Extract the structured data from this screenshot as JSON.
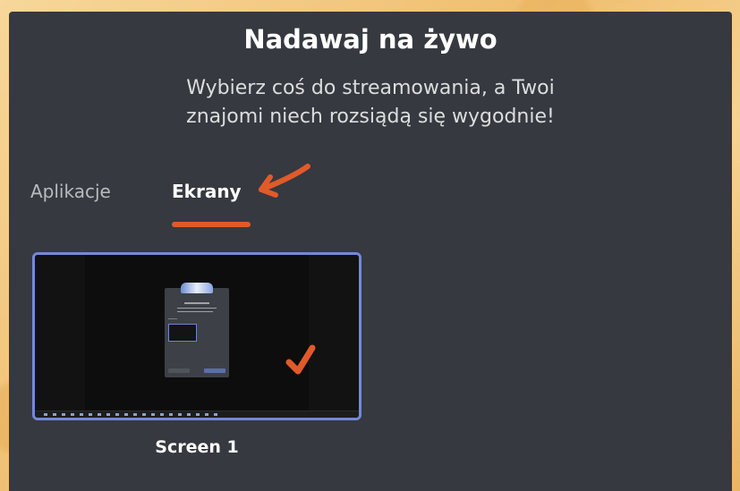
{
  "dialog": {
    "title": "Nadawaj na żywo",
    "subtitle_line1": "Wybierz coś do streamowania, a Twoi",
    "subtitle_line2": "znajomi niech rozsiądą się wygodnie!"
  },
  "tabs": [
    {
      "label": "Aplikacje",
      "active": false
    },
    {
      "label": "Ekrany",
      "active": true
    }
  ],
  "screens": [
    {
      "label": "Screen 1",
      "selected": true
    }
  ],
  "annotations": {
    "color": "#e15a2a",
    "shapes": [
      "arrow-icon",
      "underline",
      "checkmark-icon"
    ]
  },
  "colors": {
    "background": "#f3c97e",
    "modal": "#36393f",
    "selection_border": "#7289da",
    "annotation": "#e15a2a"
  }
}
